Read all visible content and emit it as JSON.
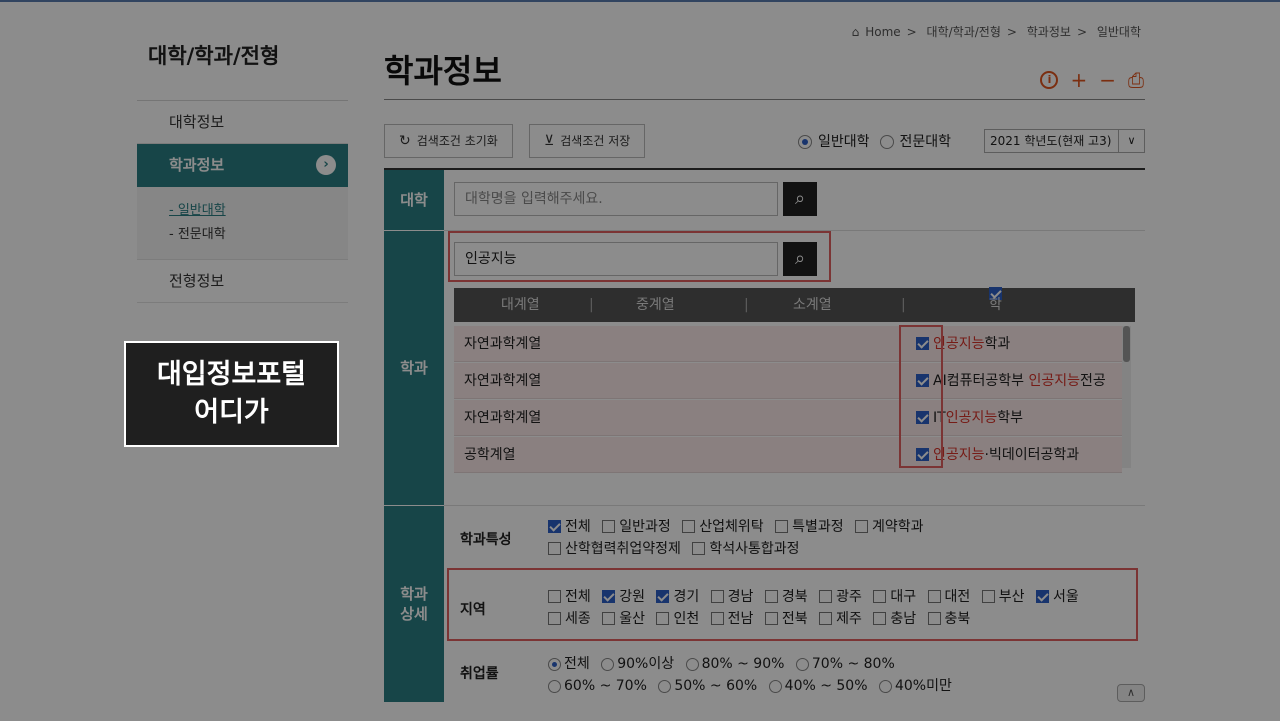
{
  "sidebar": {
    "title": "대학/학과/전형",
    "items": [
      {
        "label": "대학정보"
      },
      {
        "label": "학과정보",
        "arrow": "›"
      },
      {
        "label": "전형정보"
      }
    ],
    "sub_items": [
      {
        "label": "- 일반대학"
      },
      {
        "label": "- 전문대학"
      }
    ]
  },
  "brand": {
    "line1": "대입정보포털",
    "line2": "어디가"
  },
  "breadcrumb": {
    "home": "Home",
    "sep": ">",
    "items": [
      "대학/학과/전형",
      "학과정보",
      "일반대학"
    ]
  },
  "page_title": "학과정보",
  "tools": {
    "info": "i",
    "plus": "+",
    "minus": "−",
    "print": "⎙"
  },
  "controls": {
    "reset_label": "검색조건 초기화",
    "save_label": "검색조건 저장",
    "radio1": "일반대학",
    "radio2": "전문대학",
    "year": "2021 학년도(현재 고3)"
  },
  "form": {
    "univ_label": "대학",
    "univ_placeholder": "대학명을 입력해주세요.",
    "dept_label": "학과",
    "dept_value": "인공지능",
    "detail_label_1": "학과",
    "detail_label_2": "상세",
    "headers": {
      "large": "대계열",
      "mid": "중계열",
      "small": "소계열",
      "name": "학과명"
    },
    "rows": [
      {
        "category": "자연과학계열",
        "pre": "",
        "hl": "인공지능",
        "post": "학과"
      },
      {
        "category": "자연과학계열",
        "pre": "AI컴퓨터공학부 ",
        "hl": "인공지능",
        "post": "전공"
      },
      {
        "category": "자연과학계열",
        "pre": "IT",
        "hl": "인공지능",
        "post": "학부"
      },
      {
        "category": "공학계열",
        "pre": "",
        "hl": "인공지능",
        "post": "·빅데이터공학과"
      }
    ],
    "features_label": "학과특성",
    "features": [
      "전체",
      "일반과정",
      "산업체위탁",
      "특별과정",
      "계약학과",
      "산학협력취업약정제",
      "학석사통합과정"
    ],
    "region_label": "지역",
    "regions": [
      "전체",
      "강원",
      "경기",
      "경남",
      "경북",
      "광주",
      "대구",
      "대전",
      "부산",
      "서울",
      "세종",
      "울산",
      "인천",
      "전남",
      "전북",
      "제주",
      "충남",
      "충북"
    ],
    "employ_label": "취업률",
    "employ": [
      "전체",
      "90%이상",
      "80% ~ 90%",
      "70% ~ 80%",
      "60% ~ 70%",
      "50% ~ 60%",
      "40% ~ 50%",
      "40%미만"
    ]
  }
}
